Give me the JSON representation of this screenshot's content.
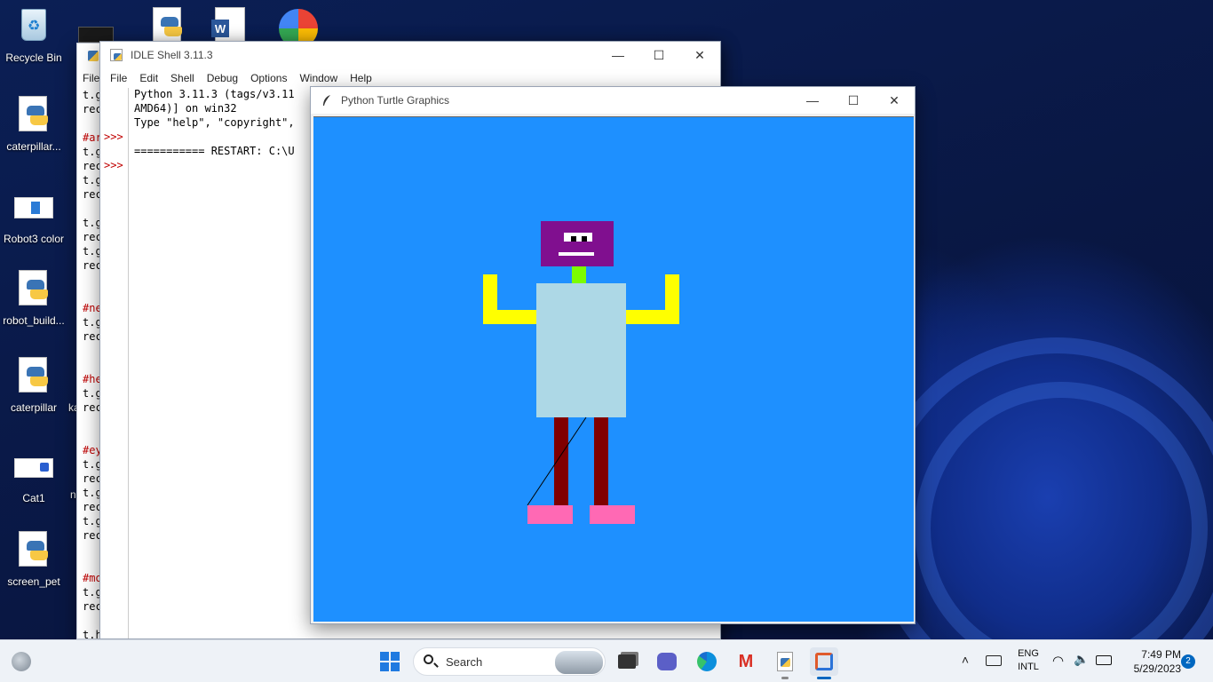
{
  "desktop": {
    "icons": [
      {
        "label": "Recycle Bin"
      },
      {
        "label": "caterpillar..."
      },
      {
        "label": "Robot3 color"
      },
      {
        "label": "robot_build..."
      },
      {
        "label": "caterpillar"
      },
      {
        "label": "Cat1"
      },
      {
        "label": "screen_pet"
      }
    ],
    "partial_labels": [
      "ka",
      "n"
    ]
  },
  "back_window": {
    "menu": [
      "File"
    ],
    "code_lines": [
      "t.g",
      "rec",
      "",
      "#ar",
      "t.g",
      "rec",
      "t.g",
      "rec",
      "",
      "t.g",
      "rec",
      "t.g",
      "rec",
      "",
      "",
      "#ne",
      "t.g",
      "rec",
      "",
      "",
      "#he",
      "t.g",
      "rec",
      "",
      "",
      "#ey",
      "t.g",
      "rec",
      "t.g",
      "rec",
      "t.g",
      "rec",
      "",
      "",
      "#mo",
      "t.g",
      "rec",
      "",
      "t.h"
    ]
  },
  "idle_shell": {
    "title": "IDLE Shell 3.11.3",
    "menu": [
      "File",
      "Edit",
      "Shell",
      "Debug",
      "Options",
      "Window",
      "Help"
    ],
    "prompts": [
      ">>>",
      ">>>"
    ],
    "lines": [
      "Python 3.11.3 (tags/v3.11",
      "AMD64)] on win32",
      "Type \"help\", \"copyright\",",
      "",
      "=========== RESTART: C:\\U"
    ]
  },
  "turtle_window": {
    "title": "Python Turtle Graphics",
    "canvas_color": "#1e90ff",
    "robot_colors": {
      "head": "#800f8f",
      "neck": "#7cfc00",
      "body": "#add8e6",
      "arms": "#ffff00",
      "legs": "#800000",
      "feet": "#ff69b4",
      "eyes_mouth": "#ffffff"
    }
  },
  "taskbar": {
    "search_placeholder": "Search",
    "language": "ENG",
    "layout": "INTL",
    "time": "7:49 PM",
    "date": "5/29/2023",
    "notification_count": "2",
    "icons": [
      "start-icon",
      "search-icon",
      "file-explorer-icon",
      "teams-chat-icon",
      "edge-icon",
      "gmail-icon",
      "python-idle-icon",
      "snipping-tool-icon"
    ]
  }
}
